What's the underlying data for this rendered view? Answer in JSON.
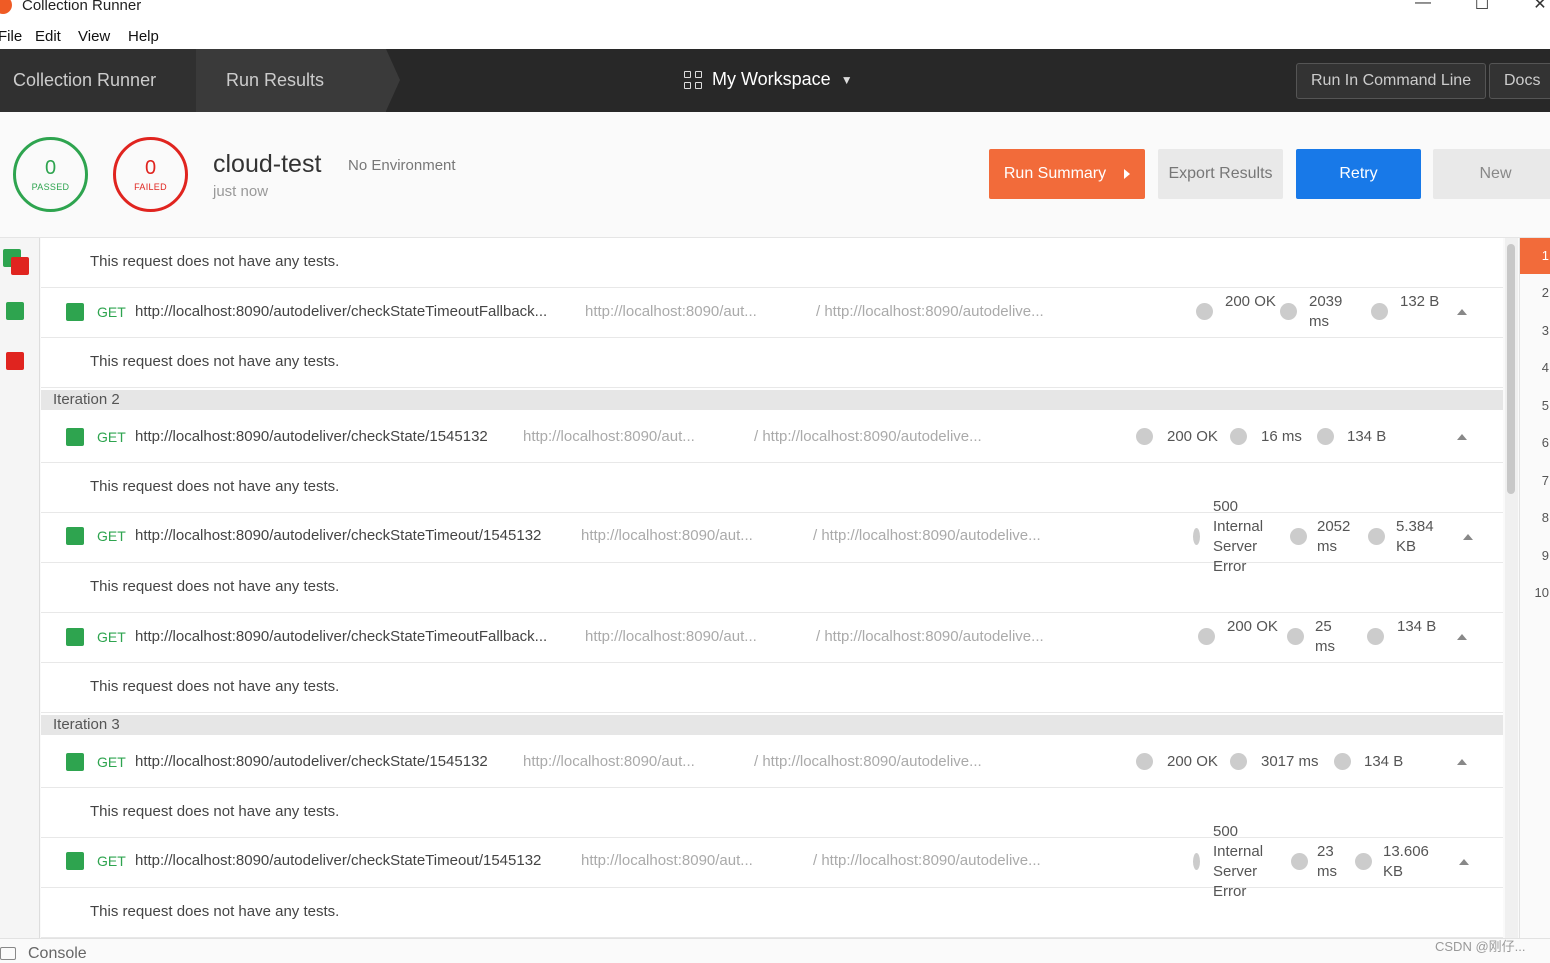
{
  "window": {
    "title": "Collection Runner",
    "min": "—",
    "max": "☐",
    "close": "✕"
  },
  "menu": [
    "File",
    "Edit",
    "View",
    "Help"
  ],
  "header": {
    "crumb1": "Collection Runner",
    "crumb2": "Run Results",
    "workspace": "My Workspace",
    "btn_cmd": "Run In Command Line",
    "btn_docs": "Docs"
  },
  "summary": {
    "passed_count": "0",
    "passed_label": "PASSED",
    "failed_count": "0",
    "failed_label": "FAILED",
    "collection": "cloud-test",
    "environment": "No Environment",
    "when": "just now",
    "btn_summary": "Run Summary",
    "btn_export": "Export Results",
    "btn_retry": "Retry",
    "btn_new": "New"
  },
  "no_tests": "This request does not have any tests.",
  "iterations": {
    "it2": "Iteration 2",
    "it3": "Iteration 3"
  },
  "requests": [
    {
      "method": "GET",
      "url": "http://localhost:8090/autodeliver/checkStateTimeoutFallback...",
      "url2": "http://localhost:8090/aut...",
      "url3": "/ http://localhost:8090/autodelive...",
      "status": "200 OK",
      "time": "2039 ms",
      "size": "132 B"
    },
    {
      "method": "GET",
      "url": "http://localhost:8090/autodeliver/checkState/1545132",
      "url2": "http://localhost:8090/aut...",
      "url3": "/ http://localhost:8090/autodelive...",
      "status": "200 OK",
      "time": "16 ms",
      "size": "134 B"
    },
    {
      "method": "GET",
      "url": "http://localhost:8090/autodeliver/checkStateTimeout/1545132",
      "url2": "http://localhost:8090/aut...",
      "url3": "/ http://localhost:8090/autodelive...",
      "status": "500 Internal Server Error",
      "time": "2052 ms",
      "size": "5.384 KB"
    },
    {
      "method": "GET",
      "url": "http://localhost:8090/autodeliver/checkStateTimeoutFallback...",
      "url2": "http://localhost:8090/aut...",
      "url3": "/ http://localhost:8090/autodelive...",
      "status": "200 OK",
      "time": "25 ms",
      "size": "134 B"
    },
    {
      "method": "GET",
      "url": "http://localhost:8090/autodeliver/checkState/1545132",
      "url2": "http://localhost:8090/aut...",
      "url3": "/ http://localhost:8090/autodelive...",
      "status": "200 OK",
      "time": "3017 ms",
      "size": "134 B"
    },
    {
      "method": "GET",
      "url": "http://localhost:8090/autodeliver/checkStateTimeout/1545132",
      "url2": "http://localhost:8090/aut...",
      "url3": "/ http://localhost:8090/autodelive...",
      "status": "500 Internal Server Error",
      "time": "23 ms",
      "size": "13.606 KB"
    }
  ],
  "iteration_index": [
    "1",
    "2",
    "3",
    "4",
    "5",
    "6",
    "7",
    "8",
    "9",
    "10"
  ],
  "console": "Console",
  "watermark": "CSDN @刚仔...",
  "colors": {
    "passed": "#2ea44f",
    "failed": "#e0241f",
    "accent": "#f26b3a",
    "retry": "#1879e8"
  }
}
